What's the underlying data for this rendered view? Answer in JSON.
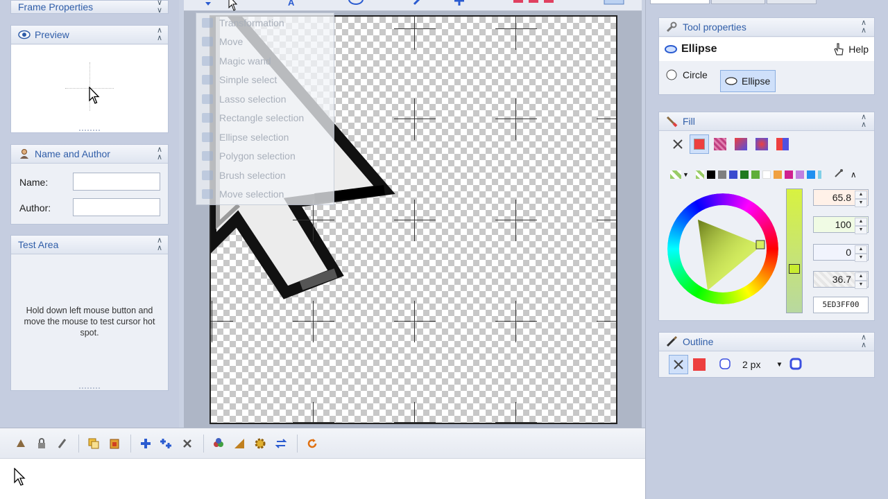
{
  "left_panel": {
    "frame_properties": {
      "title": "Frame Properties"
    },
    "preview": {
      "title": "Preview"
    },
    "name_author": {
      "title": "Name and Author",
      "name_label": "Name:",
      "author_label": "Author:",
      "name_value": "",
      "author_value": ""
    },
    "test_area": {
      "title": "Test Area",
      "hint": "Hold down left mouse button and move the mouse to test cursor hot spot."
    }
  },
  "tool_menu": {
    "items": [
      {
        "label": "Transformation",
        "icon": "transform-icon"
      },
      {
        "label": "Move",
        "icon": "move-icon"
      },
      {
        "label": "Magic wand",
        "icon": "magic-wand-icon"
      },
      {
        "label": "Simple select",
        "icon": "simple-select-icon"
      },
      {
        "label": "Lasso selection",
        "icon": "lasso-icon"
      },
      {
        "label": "Rectangle selection",
        "icon": "rectangle-select-icon"
      },
      {
        "label": "Ellipse selection",
        "icon": "ellipse-select-icon"
      },
      {
        "label": "Polygon selection",
        "icon": "polygon-select-icon"
      },
      {
        "label": "Brush selection",
        "icon": "brush-select-icon"
      },
      {
        "label": "Move selection",
        "icon": "move-selection-icon"
      }
    ]
  },
  "tool_properties": {
    "title": "Tool properties",
    "tool_name": "Ellipse",
    "help_label": "Help",
    "shape_options": [
      {
        "label": "Circle",
        "selected": false
      },
      {
        "label": "Ellipse",
        "selected": true
      }
    ]
  },
  "fill": {
    "title": "Fill",
    "fill_color": "#ED3F3F",
    "values": [
      "65.8",
      "100",
      "0",
      "36.7"
    ],
    "hex": "5ED3FF00",
    "palette": [
      "#000000",
      "#808080",
      "#1F7A1F",
      "#3A4BCF",
      "#ffffff",
      "#F0A040",
      "#D02090",
      "#C080E0",
      "#2090F0",
      "#80D0E8"
    ]
  },
  "outline": {
    "title": "Outline",
    "width": "2 px"
  },
  "colors": {
    "accent": "#2f5da8",
    "fill_red": "#ED3F3F",
    "outline_blue": "#3B4FE0"
  }
}
